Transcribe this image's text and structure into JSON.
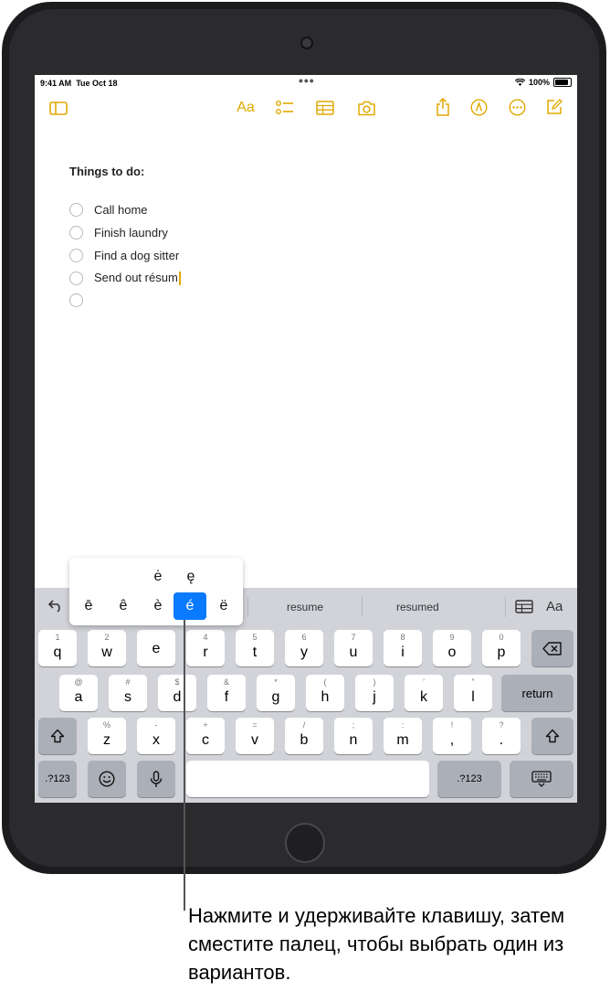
{
  "status": {
    "time": "9:41 AM",
    "date": "Tue Oct 18",
    "battery": "100%"
  },
  "toolbar": {
    "format_label": "Aa"
  },
  "note": {
    "title": "Things to do:",
    "items": [
      "Call home",
      "Finish laundry",
      "Find a dog sitter",
      "Send out résum",
      ""
    ]
  },
  "suggestions": [
    "resume",
    "resumed"
  ],
  "suggest_format_label": "Aa",
  "accent_popup": {
    "top": [
      "ė",
      "ę"
    ],
    "bottom": [
      "ē",
      "ê",
      "è",
      "é",
      "ë"
    ],
    "selected": "é"
  },
  "keyboard": {
    "row1": [
      {
        "k": "q",
        "s": "1"
      },
      {
        "k": "w",
        "s": "2"
      },
      {
        "k": "e",
        "s": ""
      },
      {
        "k": "r",
        "s": "4"
      },
      {
        "k": "t",
        "s": "5"
      },
      {
        "k": "y",
        "s": "6"
      },
      {
        "k": "u",
        "s": "7"
      },
      {
        "k": "i",
        "s": "8"
      },
      {
        "k": "o",
        "s": "9"
      },
      {
        "k": "p",
        "s": "0"
      }
    ],
    "row2": [
      {
        "k": "a",
        "s": "@"
      },
      {
        "k": "s",
        "s": "#"
      },
      {
        "k": "d",
        "s": "$"
      },
      {
        "k": "f",
        "s": "&"
      },
      {
        "k": "g",
        "s": "*"
      },
      {
        "k": "h",
        "s": "("
      },
      {
        "k": "j",
        "s": ")"
      },
      {
        "k": "k",
        "s": "’"
      },
      {
        "k": "l",
        "s": "”"
      }
    ],
    "row3": [
      {
        "k": "z",
        "s": "%"
      },
      {
        "k": "x",
        "s": "-"
      },
      {
        "k": "c",
        "s": "+"
      },
      {
        "k": "v",
        "s": "="
      },
      {
        "k": "b",
        "s": "/"
      },
      {
        "k": "n",
        "s": ";"
      },
      {
        "k": "m",
        "s": ":"
      },
      {
        "k": ",",
        "s": "!"
      },
      {
        "k": ".",
        "s": "?"
      }
    ],
    "return_label": "return",
    "numbers_label": ".?123"
  },
  "caption": "Нажмите и удерживайте клавишу, затем сместите палец, чтобы выбрать один из вариантов."
}
